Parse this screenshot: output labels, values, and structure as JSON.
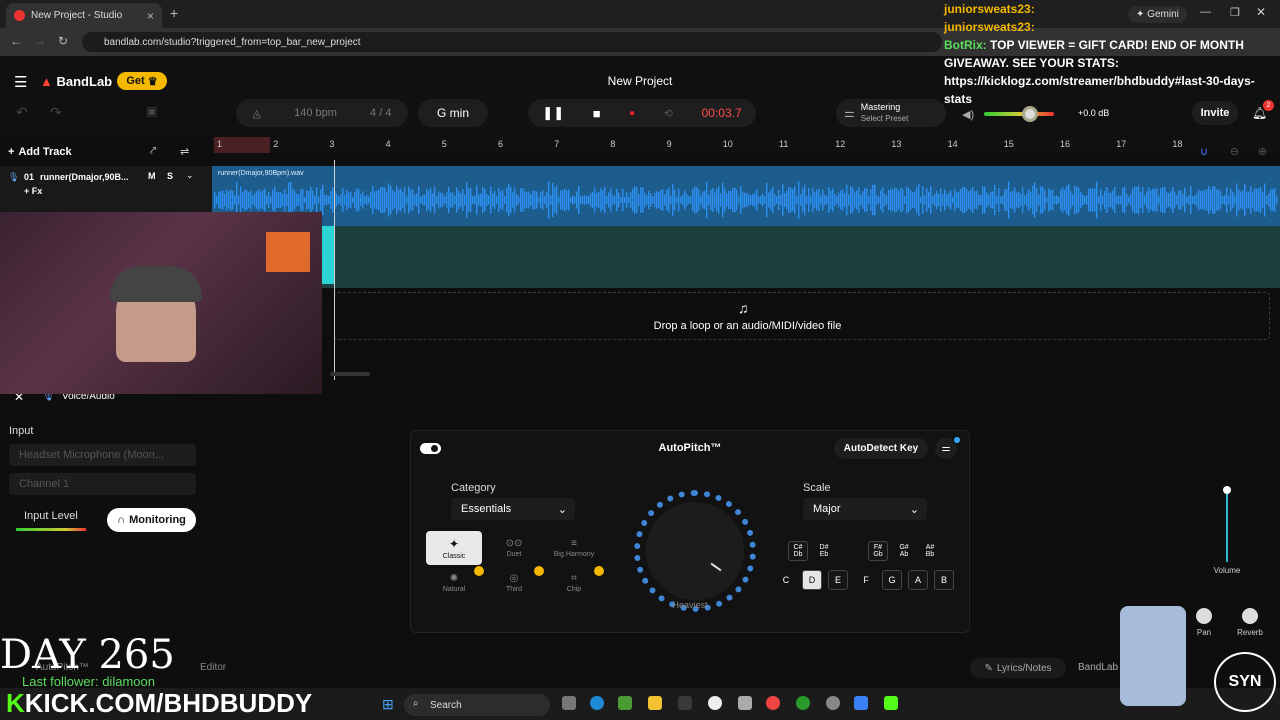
{
  "browser": {
    "tab_title": "New Project - Studio",
    "url": "bandlab.com/studio?triggered_from=top_bar_new_project",
    "gemini_label": "Gemini"
  },
  "app": {
    "logo": "BandLab",
    "get_label": "Get",
    "project_title": "New Project",
    "bpm_value": "140",
    "bpm_unit": "bpm",
    "time_signature": "4 / 4",
    "key": "G min",
    "time": "00:03.7",
    "mastering_label": "Mastering",
    "mastering_preset": "Select Preset",
    "db": "+0.0 dB",
    "invite_label": "Invite",
    "notification_count": "2",
    "accent": "#f5b800",
    "wave_color": "#2d8ff0"
  },
  "ruler": [
    "1",
    "2",
    "3",
    "4",
    "5",
    "6",
    "7",
    "8",
    "9",
    "10",
    "11",
    "12",
    "13",
    "14",
    "15",
    "16",
    "17",
    "18"
  ],
  "tracks": {
    "add_track_label": "Add Track",
    "track_number": "01",
    "track_name": "runner(Dmajor,90B...",
    "mute": "M",
    "solo": "S",
    "fx": "+ Fx",
    "clip_name": "runner(Dmajor,90Bpm).wav",
    "drop_text": "Drop a loop or an audio/MIDI/video file"
  },
  "panel": {
    "title": "Voice/Audio",
    "input_label": "Input",
    "input_device": "Headset Microphone (Moon...",
    "channel": "Channel 1",
    "input_level": "Input Level",
    "monitoring": "Monitoring",
    "autopitch_title": "AutoPitch™",
    "autodetect": "AutoDetect Key",
    "category_label": "Category",
    "category_value": "Essentials",
    "presets": [
      "Classic",
      "Duet",
      "Big Harmony",
      "Natural",
      "Third",
      "Chip"
    ],
    "knob_label": "Heaviest",
    "scale_label": "Scale",
    "scale_value": "Major",
    "sharps": [
      "C#\nDb",
      "D#\nEb",
      "F#\nGb",
      "G#\nAb",
      "A#\nBb"
    ],
    "naturals": [
      "C",
      "D",
      "E",
      "F",
      "G",
      "A",
      "B"
    ],
    "volume": "Volume",
    "pan": "Pan",
    "reverb": "Reverb",
    "editor_tab": "Editor",
    "autopitch_tab": "AutoPitch™",
    "lyrics": "Lyrics/Notes",
    "bandlab_tab": "BandLab"
  },
  "stream": {
    "chat": [
      {
        "user": "juniorsweats23:",
        "text": ""
      },
      {
        "user": "juniorsweats23:",
        "text": ""
      },
      {
        "user": "BotRix:",
        "text": "TOP VIEWER = GIFT CARD! END OF MONTH GIVEAWAY. SEE YOUR STATS: https://kicklogz.com/streamer/bhdbuddy#last-30-days-stats"
      }
    ],
    "day": "DAY 265",
    "last_follower": "Last follower: dilamoon",
    "kick": "KICK.COM/BHDBUDDY",
    "syn": "SYN"
  },
  "taskbar": {
    "search": "Search"
  }
}
